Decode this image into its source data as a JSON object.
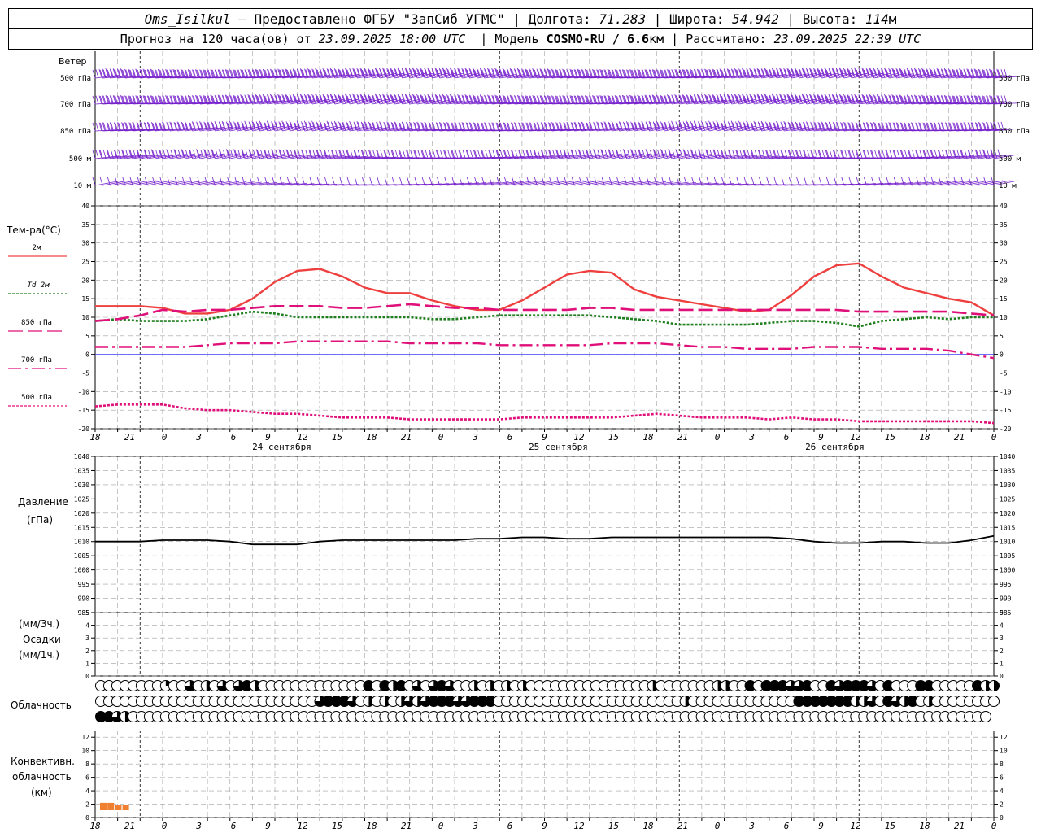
{
  "header": {
    "station": "Oms_Isilkul",
    "provider": " – Предоставлено ФГБУ \"ЗапСиб УГМС\" | Долгота: ",
    "lon": "71.283",
    "lat_label": " | Широта: ",
    "lat": "54.942",
    "alt_label": " | Высота: ",
    "alt": "114",
    "alt_unit": "м",
    "forecast_label": "Прогноз на 120 часа(ов) от ",
    "forecast_start": "23.09.2025 18:00 UTC",
    "model_label": "  | Модель ",
    "model": "COSMO-RU / 6.6",
    "model_unit": "км",
    "calc_label": " | Рассчитано: ",
    "calc_time": "23.09.2025 22:39 UTC"
  },
  "panels": {
    "wind": {
      "title": "Ветер",
      "levels": [
        "500 гПа",
        "700 гПа",
        "850 гПа",
        "500 м",
        "10 м"
      ]
    },
    "temp": {
      "title": "Тем-ра(°С)",
      "legend": [
        "2м",
        "Td  2м",
        "850 гПа",
        "700 гПа",
        "500 гПа"
      ]
    },
    "pressure": {
      "title": "Давление",
      "unit": "(гПа)"
    },
    "precip": {
      "label1": "(мм/3ч.)",
      "label2": "Осадки",
      "label3": "(мм/1ч.)"
    },
    "clouds": {
      "title": "Облачность"
    },
    "convective": {
      "label1": "Конвективн.",
      "label2": "облачность",
      "label3": "(км)"
    }
  },
  "colors": {
    "t2m": "#ef4040",
    "td2m": "#208020",
    "t850": "#e0107a",
    "t700": "#e0107a",
    "t500": "#e0107a",
    "wind": "#7722cc",
    "pressure": "#000000",
    "convective": "#f08030",
    "grid": "#a0a0a0",
    "zero": "#4040ff"
  },
  "chart_data": {
    "type": "line",
    "time_axis": {
      "hours_utc": [
        "18",
        "21",
        "0",
        "3",
        "6",
        "9",
        "12",
        "15",
        "18",
        "21",
        "0",
        "3",
        "6",
        "9",
        "12",
        "15",
        "18",
        "21",
        "0",
        "3",
        "6",
        "9",
        "12",
        "15",
        "18",
        "21",
        "0"
      ],
      "dates": [
        "24 сентября",
        "25 сентября",
        "26 сентября"
      ]
    },
    "temperature": {
      "ylim": [
        -20,
        40
      ],
      "yticks": [
        "40",
        "35",
        "30",
        "25",
        "20",
        "15",
        "10",
        "5",
        "0",
        "-5",
        "-10",
        "-15",
        "-20"
      ],
      "hours": [
        0,
        3,
        6,
        9,
        12,
        15,
        18,
        21,
        24,
        27,
        30,
        33,
        36,
        39,
        42,
        45,
        48,
        51,
        54,
        57,
        60,
        63,
        66,
        69,
        72,
        75,
        78,
        81,
        84,
        87,
        90,
        93,
        96,
        99,
        102,
        105,
        108,
        111,
        114,
        117,
        120
      ],
      "series": [
        {
          "name": "2м",
          "values": [
            13,
            13,
            13,
            12.5,
            11,
            11,
            12,
            15,
            19.5,
            22.5,
            23,
            21,
            18,
            16.5,
            16.5,
            14.5,
            13,
            12,
            12,
            14.5,
            18,
            21.5,
            22.5,
            22,
            17.5,
            15.5,
            14.5,
            13.5,
            12.5,
            11.5,
            12,
            16,
            21,
            24,
            24.5,
            21,
            18,
            16.5,
            15,
            14,
            10.5
          ]
        },
        {
          "name": "Td  2м",
          "values": [
            9,
            9.5,
            9,
            9,
            9,
            9.5,
            10.5,
            11.5,
            11,
            10,
            10,
            10,
            10,
            10,
            10,
            9.5,
            9.5,
            10,
            10.5,
            10.5,
            10.5,
            10.5,
            10.5,
            10,
            9.5,
            9,
            8,
            8,
            8,
            8,
            8.5,
            9,
            9,
            8.5,
            7.5,
            9,
            9.5,
            10,
            9.5,
            10,
            10
          ]
        },
        {
          "name": "850 гПа",
          "values": [
            9,
            9.5,
            10.5,
            12,
            11.5,
            12,
            12,
            12.5,
            13,
            13,
            13,
            12.5,
            12.5,
            13,
            13.5,
            13,
            12.5,
            12.5,
            12,
            12,
            12,
            12,
            12.5,
            12.5,
            12,
            12,
            12,
            12,
            12,
            12,
            12,
            12,
            12,
            12,
            11.5,
            11.5,
            11.5,
            11.5,
            11.5,
            11,
            10.5
          ]
        },
        {
          "name": "700 гПа",
          "values": [
            2,
            2,
            2,
            2,
            2,
            2.5,
            3,
            3,
            3,
            3.5,
            3.5,
            3.5,
            3.5,
            3.5,
            3,
            3,
            3,
            3,
            2.5,
            2.5,
            2.5,
            2.5,
            2.5,
            3,
            3,
            3,
            2.5,
            2,
            2,
            1.5,
            1.5,
            1.5,
            2,
            2,
            2,
            1.5,
            1.5,
            1.5,
            1,
            0,
            -1
          ]
        },
        {
          "name": "500 гПа",
          "values": [
            -14,
            -13.5,
            -13.5,
            -13.5,
            -14.5,
            -15,
            -15,
            -15.5,
            -16,
            -16,
            -16.5,
            -17,
            -17,
            -17,
            -17.5,
            -17.5,
            -17.5,
            -17.5,
            -17.5,
            -17,
            -17,
            -17,
            -17,
            -17,
            -16.5,
            -16,
            -16.5,
            -17,
            -17,
            -17,
            -17.5,
            -17,
            -17.5,
            -17.5,
            -18,
            -18,
            -18,
            -18,
            -18,
            -18,
            -18.5
          ]
        }
      ]
    },
    "pressure": {
      "ylim": [
        985,
        1040
      ],
      "yticks": [
        "1040",
        "1035",
        "1030",
        "1025",
        "1020",
        "1015",
        "1010",
        "1005",
        "1000",
        "995",
        "990",
        "985"
      ],
      "values": [
        1010,
        1010,
        1010,
        1010.5,
        1010.5,
        1010.5,
        1010,
        1009,
        1009,
        1009,
        1010,
        1010.5,
        1010.5,
        1010.5,
        1010.5,
        1010.5,
        1010.5,
        1011,
        1011,
        1011.5,
        1011.5,
        1011,
        1011,
        1011.5,
        1011.5,
        1011.5,
        1011.5,
        1011.5,
        1011.5,
        1011.5,
        1011.5,
        1011,
        1010,
        1009.5,
        1009.5,
        1010,
        1010,
        1009.5,
        1009.5,
        1010.5,
        1012
      ]
    },
    "precip": {
      "ylim": [
        0,
        5
      ],
      "yticks": [
        "5",
        "4",
        "3",
        "2",
        "1",
        "0"
      ],
      "values": []
    },
    "clouds": {
      "rows": [
        [
          0,
          0,
          0,
          0,
          0,
          0,
          0,
          0,
          1,
          0,
          0,
          3,
          0,
          2,
          0,
          3,
          0,
          3,
          4,
          2,
          0,
          0,
          0,
          0,
          0,
          0,
          0,
          0,
          0,
          0,
          0,
          0,
          0,
          4,
          0,
          4,
          2,
          4,
          0,
          3,
          0,
          3,
          4,
          3,
          0,
          0,
          2,
          0,
          2,
          0,
          2,
          0,
          2,
          0,
          0,
          0,
          0,
          0,
          0,
          0,
          0,
          0,
          0,
          0,
          0,
          0,
          0,
          0,
          2,
          0,
          0,
          0,
          0,
          0,
          0,
          0,
          2,
          2,
          0,
          0,
          4,
          0,
          4,
          4,
          4,
          3,
          3,
          4,
          0,
          0,
          4,
          3,
          4,
          4,
          4,
          3,
          0,
          4,
          0,
          0,
          0,
          4,
          4,
          0,
          0,
          0,
          0,
          0,
          4,
          2,
          2
        ],
        [
          0,
          0,
          0,
          0,
          0,
          0,
          0,
          0,
          0,
          0,
          0,
          0,
          0,
          0,
          0,
          0,
          0,
          0,
          0,
          0,
          0,
          0,
          0,
          0,
          0,
          0,
          0,
          3,
          4,
          4,
          4,
          3,
          0,
          2,
          0,
          2,
          0,
          2,
          3,
          2,
          3,
          4,
          4,
          4,
          3,
          3,
          4,
          4,
          4,
          0,
          0,
          0,
          0,
          0,
          0,
          0,
          0,
          0,
          0,
          0,
          0,
          0,
          0,
          0,
          0,
          0,
          0,
          0,
          0,
          0,
          0,
          0,
          2,
          0,
          0,
          0,
          0,
          0,
          0,
          0,
          0,
          0,
          0,
          0,
          0,
          0,
          4,
          4,
          4,
          4,
          4,
          4,
          4,
          2,
          2,
          3,
          0,
          4,
          3,
          2,
          4,
          0,
          2,
          0,
          0,
          0,
          0,
          0,
          0,
          0,
          0
        ],
        [
          4,
          4,
          3,
          2,
          0,
          0,
          0,
          0,
          0,
          0,
          0,
          0,
          0,
          0,
          0,
          0,
          0,
          0,
          0,
          0,
          0,
          0,
          0,
          0,
          0,
          0,
          0,
          0,
          0,
          0,
          0,
          0,
          0,
          0,
          0,
          0,
          0,
          0,
          0,
          0,
          0,
          0,
          0,
          0,
          0,
          0,
          0,
          0,
          0,
          0,
          0,
          0,
          0,
          0,
          0,
          0,
          0,
          0,
          0,
          0,
          0,
          0,
          0,
          0,
          0,
          0,
          0,
          0,
          0,
          0,
          0,
          0,
          0,
          0,
          0,
          0,
          0,
          0,
          0,
          0,
          0,
          0,
          0,
          0,
          0,
          0,
          0,
          0,
          0,
          0,
          0,
          0,
          0,
          0,
          0,
          0,
          0,
          0,
          0,
          0,
          0,
          0,
          0,
          0,
          0,
          0,
          0,
          0,
          0,
          0
        ]
      ]
    },
    "convective": {
      "ylim": [
        0,
        13
      ],
      "yticks": [
        "12",
        "10",
        "8",
        "6",
        "4",
        "2",
        "0"
      ],
      "hours": [
        0,
        1,
        2,
        3
      ],
      "values": [
        2.2,
        2.2,
        1.9,
        1.9
      ]
    },
    "wind": {
      "levels": [
        "500 гПа",
        "700 гПа",
        "850 гПа",
        "500 м",
        "10 м"
      ],
      "speed_ms": [
        28,
        24,
        18,
        14,
        4
      ],
      "direction": "западный"
    }
  }
}
